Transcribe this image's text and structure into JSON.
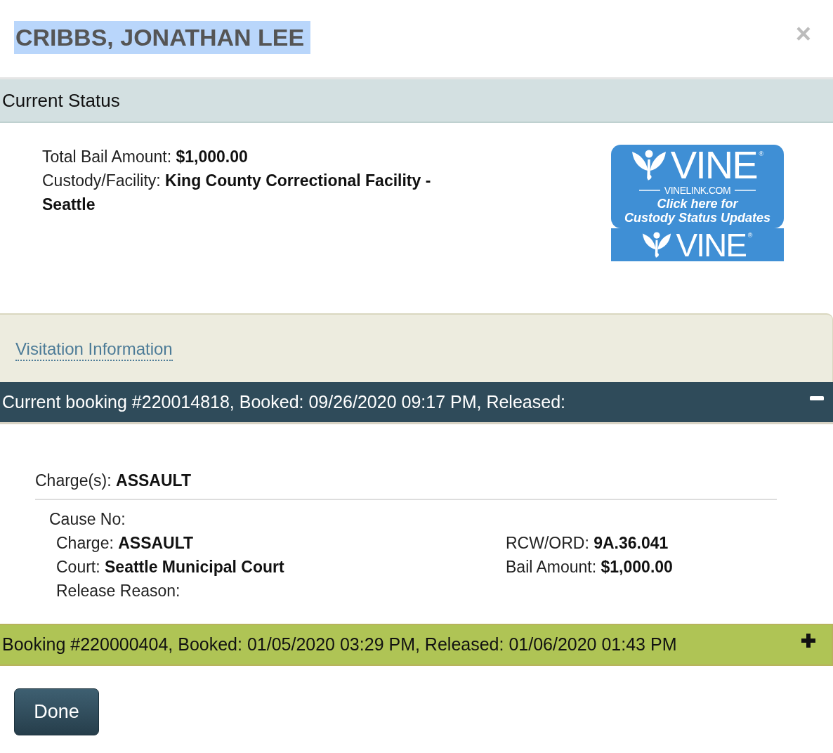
{
  "dialog": {
    "title": {
      "text": "CRIBBS, JONATHAN LEE",
      "highlighted": true
    },
    "close": "×"
  },
  "current_status": {
    "heading": "Current Status",
    "fields": [
      {
        "label": "Total Bail Amount:",
        "value": "$1,000.00"
      },
      {
        "label": "Custody/Facility:",
        "value": "King County Correctional Facility - Seattle"
      }
    ],
    "vine_banner": {
      "brand": "VINE$^{®}$",
      "site": "VINELINK.COM",
      "cta_lines": [
        "Click here for",
        "Custody Status Updates"
      ],
      "footer_brand": "VINE$^{®}$"
    }
  },
  "visitation": {
    "link": "Visitation Information"
  },
  "bookings": [
    {
      "kind": "current",
      "header": "Current booking #220014818, Booked: 09/26/2020 09:17 PM, Released:",
      "expanded": true,
      "charges_summary": {
        "label": "Charge(s):",
        "value": "ASSAULT"
      },
      "charges": [
        {
          "cause_label": "Cause No:",
          "left": [
            {
              "label": "Charge:",
              "value": "ASSAULT"
            },
            {
              "label": "Court:",
              "value": "Seattle Municipal Court"
            },
            {
              "label": "Release Reason:"
            }
          ],
          "right": [
            {
              "label": "RCW/ORD:",
              "value": "9A.36.041"
            },
            {
              "label": "Bail Amount:",
              "value": "$1,000.00"
            }
          ]
        }
      ]
    },
    {
      "kind": "past",
      "header": "Booking #220000404, Booked: 01/05/2020 03:29 PM, Released: 01/06/2020 01:43 PM",
      "expanded": false
    }
  ],
  "done_button": "Done"
}
